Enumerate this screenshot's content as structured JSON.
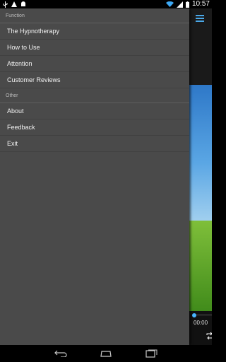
{
  "status_bar": {
    "time": "10:57",
    "left_icons": [
      "usb-icon",
      "warning-icon",
      "android-icon"
    ],
    "right_icons": [
      "wifi-icon",
      "signal-icon",
      "battery-icon"
    ]
  },
  "drawer": {
    "sections": [
      {
        "header": "Function",
        "items": [
          {
            "label": "The Hypnotherapy"
          },
          {
            "label": "How to Use"
          },
          {
            "label": "Attention"
          },
          {
            "label": "Customer Reviews"
          }
        ]
      },
      {
        "header": "Other",
        "items": [
          {
            "label": "About"
          },
          {
            "label": "Feedback"
          },
          {
            "label": "Exit"
          }
        ]
      }
    ]
  },
  "background_app": {
    "menu_icon": "hamburger-menu-icon",
    "time_label": "00:00",
    "accent_color": "#4aa8e8"
  },
  "nav_bar": {
    "buttons": [
      "back-icon",
      "home-icon",
      "recent-apps-icon"
    ]
  }
}
